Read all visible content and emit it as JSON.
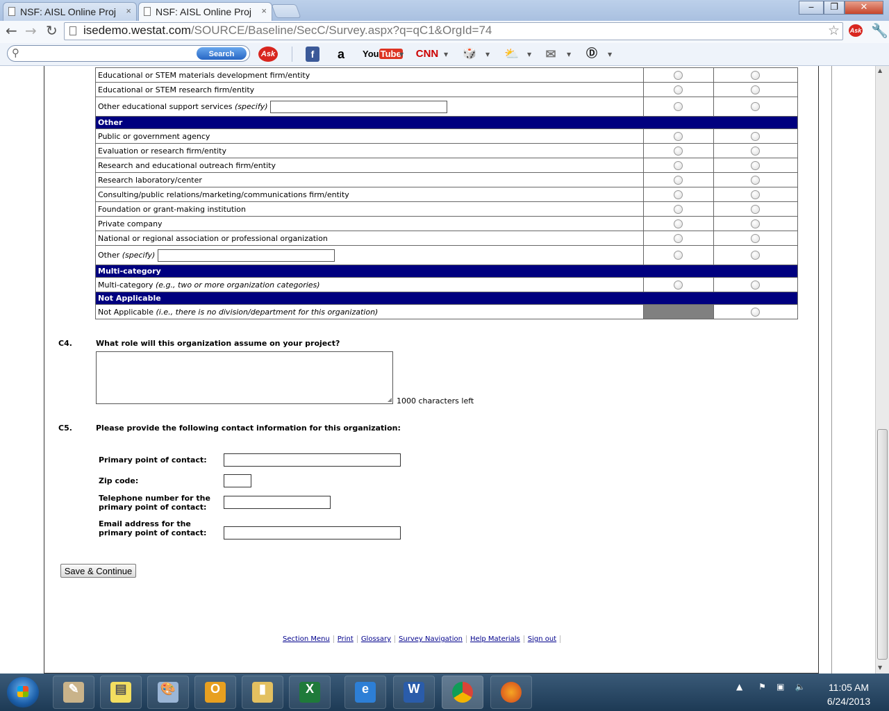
{
  "browser": {
    "tabs": [
      {
        "title": "NSF: AISL Online Proj",
        "active": false
      },
      {
        "title": "NSF: AISL Online Proj",
        "active": true
      }
    ],
    "url_host": "isedemo.westat.com",
    "url_path": "/SOURCE/Baseline/SecC/Survey.aspx?q=qC1&OrgId=74",
    "search_button": "Search",
    "toolbar_icons": [
      "ask-icon",
      "facebook-icon",
      "amazon-icon",
      "youtube-icon",
      "cnn-icon",
      "games-icon",
      "weather-icon",
      "mail-icon",
      "dictionary-icon"
    ]
  },
  "grid": {
    "rows": [
      {
        "type": "item",
        "label": "Educational or STEM materials development firm/entity"
      },
      {
        "type": "item",
        "label": "Educational or STEM research firm/entity"
      },
      {
        "type": "specify",
        "label": "Other educational support services",
        "specify": "(specify)"
      },
      {
        "type": "category",
        "label": "Other"
      },
      {
        "type": "item",
        "label": "Public or government agency"
      },
      {
        "type": "item",
        "label": "Evaluation or research firm/entity"
      },
      {
        "type": "item",
        "label": "Research and educational outreach firm/entity"
      },
      {
        "type": "item",
        "label": "Research laboratory/center"
      },
      {
        "type": "item",
        "label": "Consulting/public relations/marketing/communications firm/entity"
      },
      {
        "type": "item",
        "label": "Foundation or grant-making institution"
      },
      {
        "type": "item",
        "label": "Private company"
      },
      {
        "type": "item",
        "label": "National or regional association or professional organization"
      },
      {
        "type": "specify",
        "label": "Other",
        "specify": "(specify)"
      },
      {
        "type": "category",
        "label": "Multi-category"
      },
      {
        "type": "item",
        "label": "Multi-category",
        "note": "(e.g., two or more organization categories)"
      },
      {
        "type": "category",
        "label": "Not Applicable"
      },
      {
        "type": "item-na",
        "label": "Not Applicable",
        "note": "(i.e., there is no division/department for this organization)"
      }
    ]
  },
  "c4": {
    "number": "C4.",
    "question": "What role will this organization assume on your project?",
    "chars_left": "1000 characters left"
  },
  "c5": {
    "number": "C5.",
    "question": "Please provide the following contact information for this organization:",
    "fields": {
      "contact_label": "Primary point of contact:",
      "zip_label": "Zip code:",
      "phone_label_1": "Telephone number for the",
      "phone_label_2": "primary point of contact:",
      "email_label_1": "Email address for the",
      "email_label_2": "primary point of contact:"
    }
  },
  "save_button": "Save & Continue",
  "footer_links": [
    "Section Menu",
    "Print",
    "Glossary",
    "Survey Navigation",
    "Help Materials",
    "Sign out"
  ],
  "taskbar": {
    "time": "11:05 AM",
    "date": "6/24/2013"
  }
}
